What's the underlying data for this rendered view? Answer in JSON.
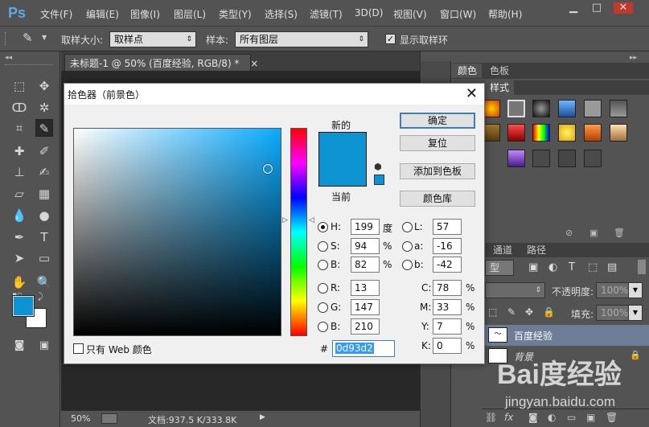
{
  "app": {
    "logo": "Ps"
  },
  "menu": [
    "文件(F)",
    "编辑(E)",
    "图像(I)",
    "图层(L)",
    "类型(Y)",
    "选择(S)",
    "滤镜(T)",
    "3D(D)",
    "视图(V)",
    "窗口(W)",
    "帮助(H)"
  ],
  "options": {
    "sample_size_label": "取样大小:",
    "sample_size_value": "取样点",
    "sample_label": "样本:",
    "sample_value": "所有图层",
    "show_ring_label": "显示取样环"
  },
  "document": {
    "tab_title": "未标题-1 @ 50% (百度经验, RGB/8) *",
    "close": "×",
    "zoom": "50%",
    "doc_info": "文档:937.5 K/333.8K"
  },
  "panels": {
    "color_tab": "颜色",
    "swatches_tab": "色板",
    "styles_tab": "样式",
    "channels_tab": "通道",
    "paths_tab": "路径",
    "kind_label": "型",
    "opacity_label": "不透明度:",
    "opacity_value": "100%",
    "fill_label": "填充:",
    "fill_value": "100%",
    "layers": [
      {
        "name": "百度经验"
      },
      {
        "name": "背景"
      }
    ]
  },
  "picker": {
    "title": "拾色器（前景色）",
    "new_label": "新的",
    "current_label": "当前",
    "new_color": "#0d93d2",
    "current_color": "#0d93d2",
    "buttons": {
      "ok": "确定",
      "reset": "复位",
      "add_swatch": "添加到色板",
      "color_libraries": "颜色库"
    },
    "fields": {
      "H": {
        "label": "H:",
        "value": "199",
        "unit": "度"
      },
      "S": {
        "label": "S:",
        "value": "94",
        "unit": "%"
      },
      "B": {
        "label": "B:",
        "value": "82",
        "unit": "%"
      },
      "R": {
        "label": "R:",
        "value": "13"
      },
      "G": {
        "label": "G:",
        "value": "147"
      },
      "Bl": {
        "label": "B:",
        "value": "210"
      },
      "L": {
        "label": "L:",
        "value": "57"
      },
      "a": {
        "label": "a:",
        "value": "-16"
      },
      "b": {
        "label": "b:",
        "value": "-42"
      },
      "C": {
        "label": "C:",
        "value": "78",
        "unit": "%"
      },
      "M": {
        "label": "M:",
        "value": "33",
        "unit": "%"
      },
      "Y": {
        "label": "Y:",
        "value": "7",
        "unit": "%"
      },
      "K": {
        "label": "K:",
        "value": "0",
        "unit": "%"
      }
    },
    "web_only_label": "只有 Web 颜色",
    "hex_label": "#",
    "hex_value": "0d93d2"
  },
  "watermark": {
    "brand": "Bai度经验",
    "url": "jingyan.baidu.com"
  },
  "colors": {
    "foreground": "#0d93d2",
    "background": "#ffffff",
    "hue_field": "#0aaaff"
  }
}
